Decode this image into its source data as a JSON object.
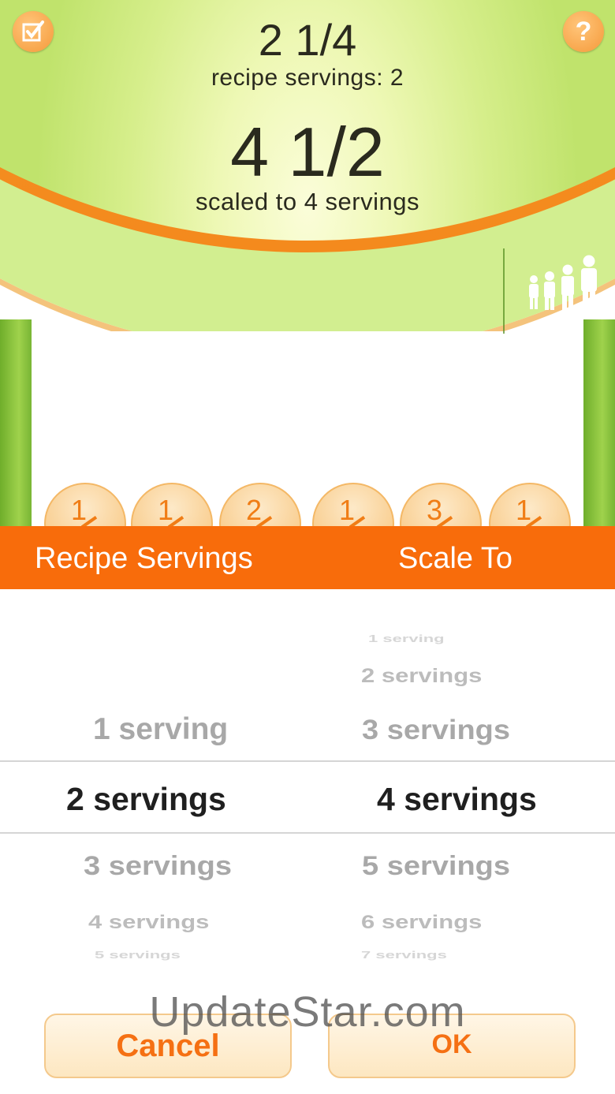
{
  "display": {
    "original_amount": "2 1/4",
    "original_label": "recipe servings: 2",
    "scaled_amount": "4 1/2",
    "scaled_label": "scaled to 4 servings",
    "check_icon": "checkbox-icon",
    "help_label": "?",
    "people_icon": "people-group-icon"
  },
  "fraction_coins": [
    "1",
    "1",
    "2",
    "1",
    "3",
    "1"
  ],
  "picker": {
    "header_left": "Recipe Servings",
    "header_right": "Scale To",
    "left_column": [
      "1 serving",
      "2 servings",
      "3 servings",
      "4 servings",
      "5 servings"
    ],
    "left_selected": "2 servings",
    "right_column": [
      "1 serving",
      "2 servings",
      "3 servings",
      "4 servings",
      "5 servings",
      "6 servings",
      "7 servings"
    ],
    "right_selected": "4 servings"
  },
  "buttons": {
    "cancel": "Cancel",
    "ok": "OK"
  },
  "watermark": "UpdateStar.com",
  "colors": {
    "accent_orange": "#f86c0b",
    "screen_green": "#a6d24d",
    "button_text": "#f57013"
  }
}
